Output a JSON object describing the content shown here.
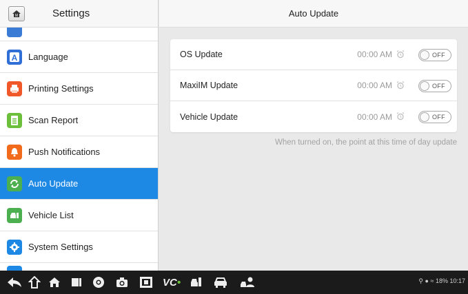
{
  "sidebar": {
    "title": "Settings",
    "items": [
      {
        "label": "Language",
        "icon": "language-icon",
        "color": "#2f6fd6"
      },
      {
        "label": "Printing Settings",
        "icon": "printer-icon",
        "color": "#f0582a"
      },
      {
        "label": "Scan Report",
        "icon": "report-icon",
        "color": "#6cbf3a"
      },
      {
        "label": "Push Notifications",
        "icon": "bell-icon",
        "color": "#f26a1b"
      },
      {
        "label": "Auto Update",
        "icon": "refresh-icon",
        "color": "#4caf50"
      },
      {
        "label": "Vehicle List",
        "icon": "vehicle-list-icon",
        "color": "#4caf50"
      },
      {
        "label": "System Settings",
        "icon": "gear-icon",
        "color": "#1e88e5"
      }
    ],
    "active_index": 4
  },
  "main": {
    "title": "Auto Update",
    "rows": [
      {
        "label": "OS Update",
        "time": "00:00 AM",
        "toggle": "OFF"
      },
      {
        "label": "MaxiIM Update",
        "time": "00:00 AM",
        "toggle": "OFF"
      },
      {
        "label": "Vehicle Update",
        "time": "00:00 AM",
        "toggle": "OFF"
      }
    ],
    "hint": "When turned on, the point at this time of day update"
  },
  "navbar": {
    "status": "18% 10:17"
  },
  "colors": {
    "accent": "#1e88e5",
    "navbar": "#1b1b1b"
  }
}
